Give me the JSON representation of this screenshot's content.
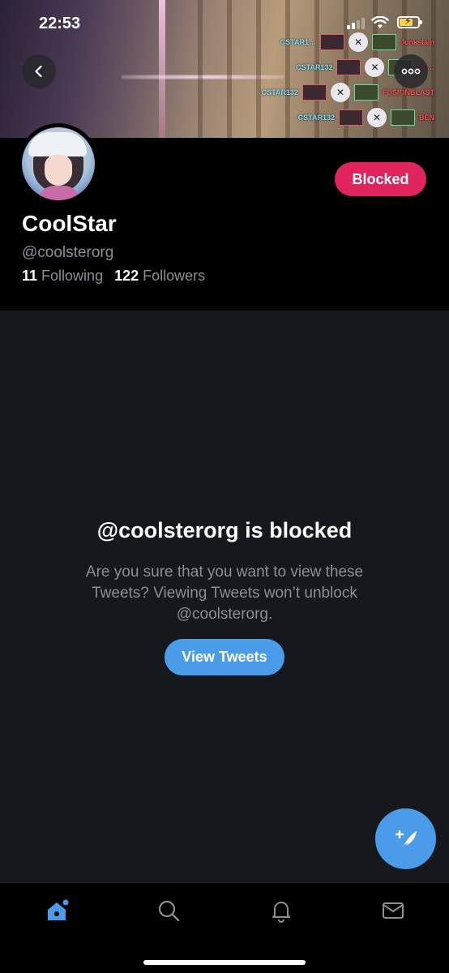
{
  "status_bar": {
    "time": "22:53"
  },
  "banner": {
    "killfeed": [
      {
        "left_name": "CSTAR1…",
        "right_name": "Junkstain"
      },
      {
        "left_name": "CSTAR132",
        "right_name": "BE…"
      },
      {
        "left_name": "CSTAR132",
        "right_name": "FUSIONBLAST"
      },
      {
        "left_name": "CSTAR132",
        "right_name": "BEN"
      }
    ]
  },
  "profile": {
    "display_name": "CoolStar",
    "handle": "@coolsterorg",
    "following_count": "11",
    "following_label": "Following",
    "followers_count": "122",
    "followers_label": "Followers",
    "blocked_label": "Blocked"
  },
  "blocked_notice": {
    "title": "@coolsterorg is blocked",
    "description": "Are you sure that you want to view these Tweets? Viewing Tweets won’t unblock @coolsterorg.",
    "view_button": "View Tweets"
  },
  "tabbar": {
    "tabs": [
      {
        "icon": "home-icon",
        "active": true
      },
      {
        "icon": "search-icon",
        "active": false
      },
      {
        "icon": "bell-icon",
        "active": false
      },
      {
        "icon": "mail-icon",
        "active": false
      }
    ]
  },
  "colors": {
    "accent": "#4a9be8",
    "blocked": "#e0245e",
    "background": "#15181c",
    "muted_text": "#8b8f94"
  }
}
